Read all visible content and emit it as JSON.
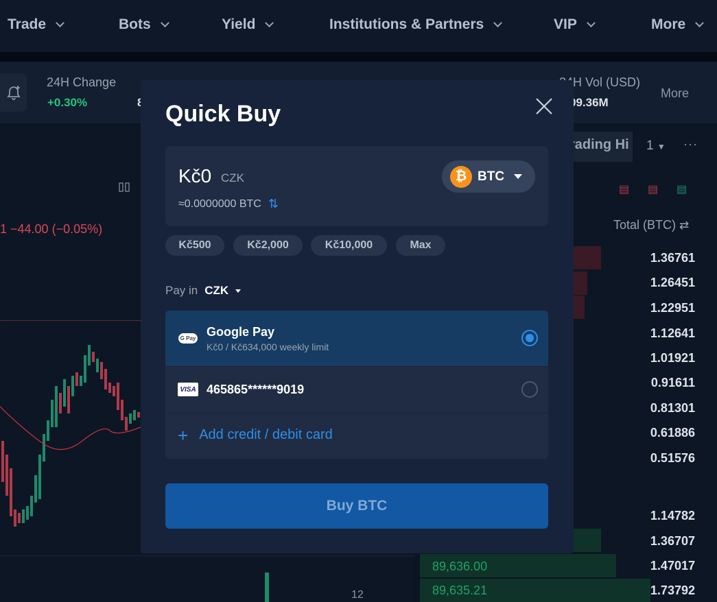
{
  "nav": {
    "items": [
      "Trade",
      "Bots",
      "Yield",
      "Institutions & Partners",
      "VIP",
      "More"
    ]
  },
  "ticker": {
    "change_label": "24H Change",
    "change_value": "+0.30%",
    "vol_usd_label": "24H Vol (USD)",
    "vol_usd_value_partial": "09.36M",
    "more_label": "More",
    "partial_left_value": "8"
  },
  "chart": {
    "price_change": "1  −44.00 (−0.05%)",
    "bottom_tick": "12"
  },
  "orderbook": {
    "tab_label": "rading Hi",
    "depth_value": "1",
    "total_label": "Total (BTC)",
    "ask_totals": [
      "1.36761",
      "1.26451",
      "1.22951",
      "1.12641",
      "1.01921",
      "0.91611",
      "0.81301",
      "0.61886",
      "0.51576"
    ],
    "bid_totals": [
      "1.14782",
      "1.36707",
      "1.47017",
      "1.73792"
    ],
    "bid_prices": [
      "89,636.00",
      "89,635.21"
    ]
  },
  "modal": {
    "title": "Quick Buy",
    "amount_value": "Kč0",
    "amount_currency": "CZK",
    "amount_estimate": "≈0.0000000 BTC",
    "coin": "BTC",
    "coin_icon_glyph": "₿",
    "presets": [
      "Kč500",
      "Kč2,000",
      "Kč10,000",
      "Max"
    ],
    "pay_in_label": "Pay in",
    "pay_in_currency": "CZK",
    "payment_options": [
      {
        "name": "Google Pay",
        "subtitle": "Kč0 / Kč634,000 weekly limit",
        "icon": "google-pay-icon",
        "selected": true,
        "icon_text": "G Pay"
      },
      {
        "name": "465865******9019",
        "icon": "visa-icon",
        "selected": false,
        "icon_text": "VISA"
      }
    ],
    "add_card_label": "Add credit / debit card",
    "buy_button_label": "Buy BTC"
  },
  "colors": {
    "accent": "#2f8ee8",
    "positive": "#26c47b",
    "negative": "#d9475a",
    "bitcoin": "#f7931a",
    "buy_button": "#1258a3"
  }
}
